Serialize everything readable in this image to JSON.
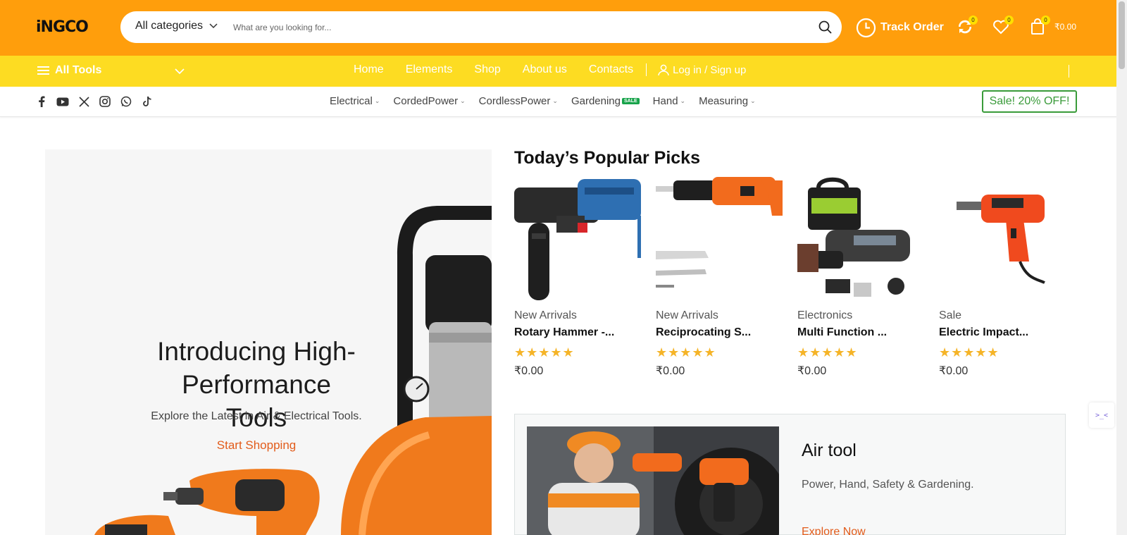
{
  "header": {
    "logo": "iNGCO",
    "search_category": "All categories",
    "search_placeholder": "What are you looking for...",
    "track_order": "Track Order",
    "compare_count": "0",
    "wishlist_count": "0",
    "cart_count": "0",
    "cart_total": "₹0.00"
  },
  "navbar": {
    "all_tools": "All Tools",
    "links": [
      "Home",
      "Elements",
      "Shop",
      "About us",
      "Contacts"
    ],
    "login": "Log in / Sign up"
  },
  "catbar": {
    "social_icons": [
      "facebook-icon",
      "youtube-icon",
      "x-icon",
      "instagram-icon",
      "whatsapp-icon",
      "tiktok-icon"
    ],
    "categories": [
      "Electrical",
      "CordedPower",
      "CordlessPower",
      "Gardening",
      "Hand",
      "Measuring"
    ],
    "gardening_badge": "SALE",
    "sale_button": "Sale! 20% OFF!"
  },
  "hero": {
    "title": "Introducing High-Performance Tools",
    "subtitle": "Explore the Latest in Air & Electrical Tools.",
    "cta": "Start Shopping"
  },
  "picks": {
    "title": "Today’s Popular Picks",
    "products": [
      {
        "category": "New Arrivals",
        "name": "Rotary Hammer -...",
        "stars": "★★★★★",
        "price": "₹0.00"
      },
      {
        "category": "New Arrivals",
        "name": "Reciprocating S...",
        "stars": "★★★★★",
        "price": "₹0.00"
      },
      {
        "category": "Electronics",
        "name": "Multi Function ...",
        "stars": "★★★★★",
        "price": "₹0.00"
      },
      {
        "category": "Sale",
        "name": "Electric Impact...",
        "stars": "★★★★★",
        "price": "₹0.00"
      }
    ]
  },
  "banner": {
    "title": "Air tool",
    "subtitle": "Power, Hand, Safety & Gardening.",
    "cta": "Explore Now"
  },
  "colors": {
    "topbar": "#ff9e0c",
    "navbar": "#fddc22",
    "accent_orange": "#e25c1b",
    "sale_green": "#3a9b3a",
    "star": "#f5b428"
  }
}
